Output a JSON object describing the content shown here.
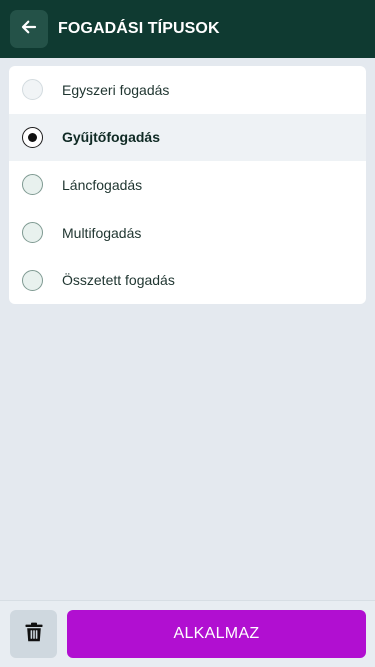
{
  "header": {
    "title": "FOGADÁSI TÍPUSOK",
    "back_icon": "arrow-left-icon"
  },
  "options": [
    {
      "label": "Egyszeri fogadás",
      "state": "disabled"
    },
    {
      "label": "Gyűjtőfogadás",
      "state": "selected"
    },
    {
      "label": "Láncfogadás",
      "state": "unselected"
    },
    {
      "label": "Multifogadás",
      "state": "unselected"
    },
    {
      "label": "Összetett fogadás",
      "state": "unselected"
    }
  ],
  "footer": {
    "delete_icon": "trash-icon",
    "apply_label": "ALKALMAZ"
  },
  "colors": {
    "header_bg": "#0f3a31",
    "accent": "#b10fd1",
    "page_bg": "#e4e9ef"
  }
}
